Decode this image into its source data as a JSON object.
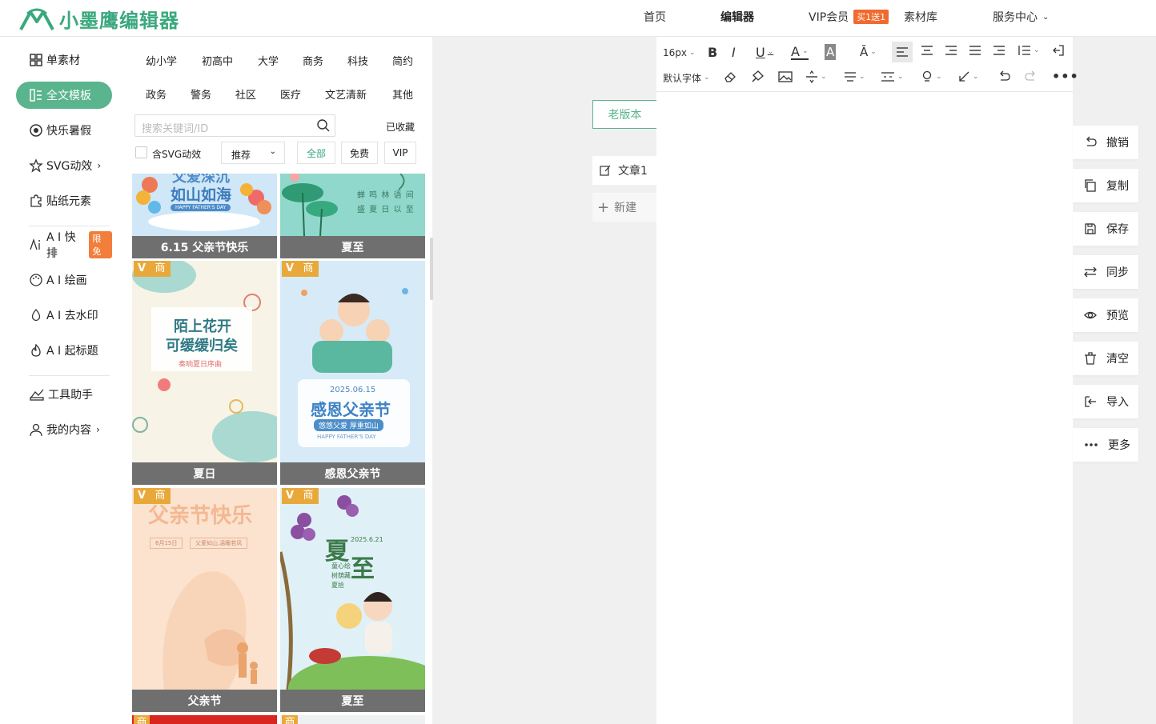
{
  "header": {
    "app_name": "小墨鹰编辑器",
    "nav": {
      "home": "首页",
      "editor": "编辑器",
      "vip": "VIP会员",
      "vip_badge": "买1送1",
      "materials": "素材库",
      "service": "服务中心"
    }
  },
  "sidebar": {
    "items": [
      {
        "label": "单素材",
        "icon": "grid-icon"
      },
      {
        "label": "全文模板",
        "icon": "template-icon",
        "active": true
      },
      {
        "label": "快乐暑假",
        "icon": "ball-icon"
      },
      {
        "label": "SVG动效",
        "icon": "star-icon"
      },
      {
        "label": "贴纸元素",
        "icon": "puzzle-icon"
      },
      {
        "label": "A I 快排",
        "icon": "ai-icon",
        "badge": "限免"
      },
      {
        "label": "A I 绘画",
        "icon": "palette-icon"
      },
      {
        "label": "A I 去水印",
        "icon": "drop-icon"
      },
      {
        "label": "A I 起标题",
        "icon": "fire-icon"
      },
      {
        "label": "工具助手",
        "icon": "tools-icon"
      },
      {
        "label": "我的内容",
        "icon": "user-icon"
      }
    ]
  },
  "templates": {
    "categories": [
      "幼小学",
      "初高中",
      "大学",
      "商务",
      "科技",
      "简约",
      "政务",
      "警务",
      "社区",
      "医疗",
      "文艺清新",
      "其他"
    ],
    "search_placeholder": "搜索关键词/ID",
    "favorites": "已收藏",
    "svg_filter": "含SVG动效",
    "sort": "推荐",
    "filters": [
      "全部",
      "免费",
      "VIP"
    ],
    "badges": {
      "v": "V",
      "shang": "商"
    },
    "cards": [
      {
        "label": "6.15 父亲节快乐",
        "art_lines": [
          "父爱深沉",
          "如山如海",
          "HAPPY FATHER'S DAY"
        ]
      },
      {
        "label": "夏至",
        "art_lines": [
          "蝉 鸣 林 语 间",
          "盛 夏 日 以 至"
        ]
      },
      {
        "label": "夏日",
        "art_lines": [
          "陌上花开",
          "可缓缓归矣",
          "奏响夏日序曲"
        ]
      },
      {
        "label": "感恩父亲节",
        "art_lines": [
          "2025.06.15",
          "感恩父亲节",
          "悠悠父爱 厚重如山",
          "HAPPY FATHER'S DAY"
        ]
      },
      {
        "label": "父亲节",
        "art_lines": [
          "父亲节快乐",
          "6月15日",
          "父爱如山,温暖若风"
        ]
      },
      {
        "label": "夏至",
        "art_lines": [
          "夏",
          "至",
          "2025.6.21",
          "童心绘",
          "树荫藏",
          "夏拾"
        ]
      }
    ]
  },
  "docs": {
    "old_version": "老版本",
    "doc1": "文章1",
    "new": "新建"
  },
  "editor": {
    "font_size": "16px",
    "font_family": "默认字体"
  },
  "actions": [
    {
      "label": "撤销",
      "icon": "undo-icon"
    },
    {
      "label": "复制",
      "icon": "copy-icon"
    },
    {
      "label": "保存",
      "icon": "save-icon"
    },
    {
      "label": "同步",
      "icon": "sync-icon"
    },
    {
      "label": "预览",
      "icon": "eye-icon"
    },
    {
      "label": "清空",
      "icon": "trash-icon"
    },
    {
      "label": "导入",
      "icon": "import-icon"
    },
    {
      "label": "更多",
      "icon": "more-icon"
    }
  ],
  "colors": {
    "accent": "#5ab48d",
    "brand": "#3aa87e",
    "vip_badge": "#f06b2f",
    "card_label": "#6f6f6f",
    "commercial_badge": "#e9a93a"
  }
}
